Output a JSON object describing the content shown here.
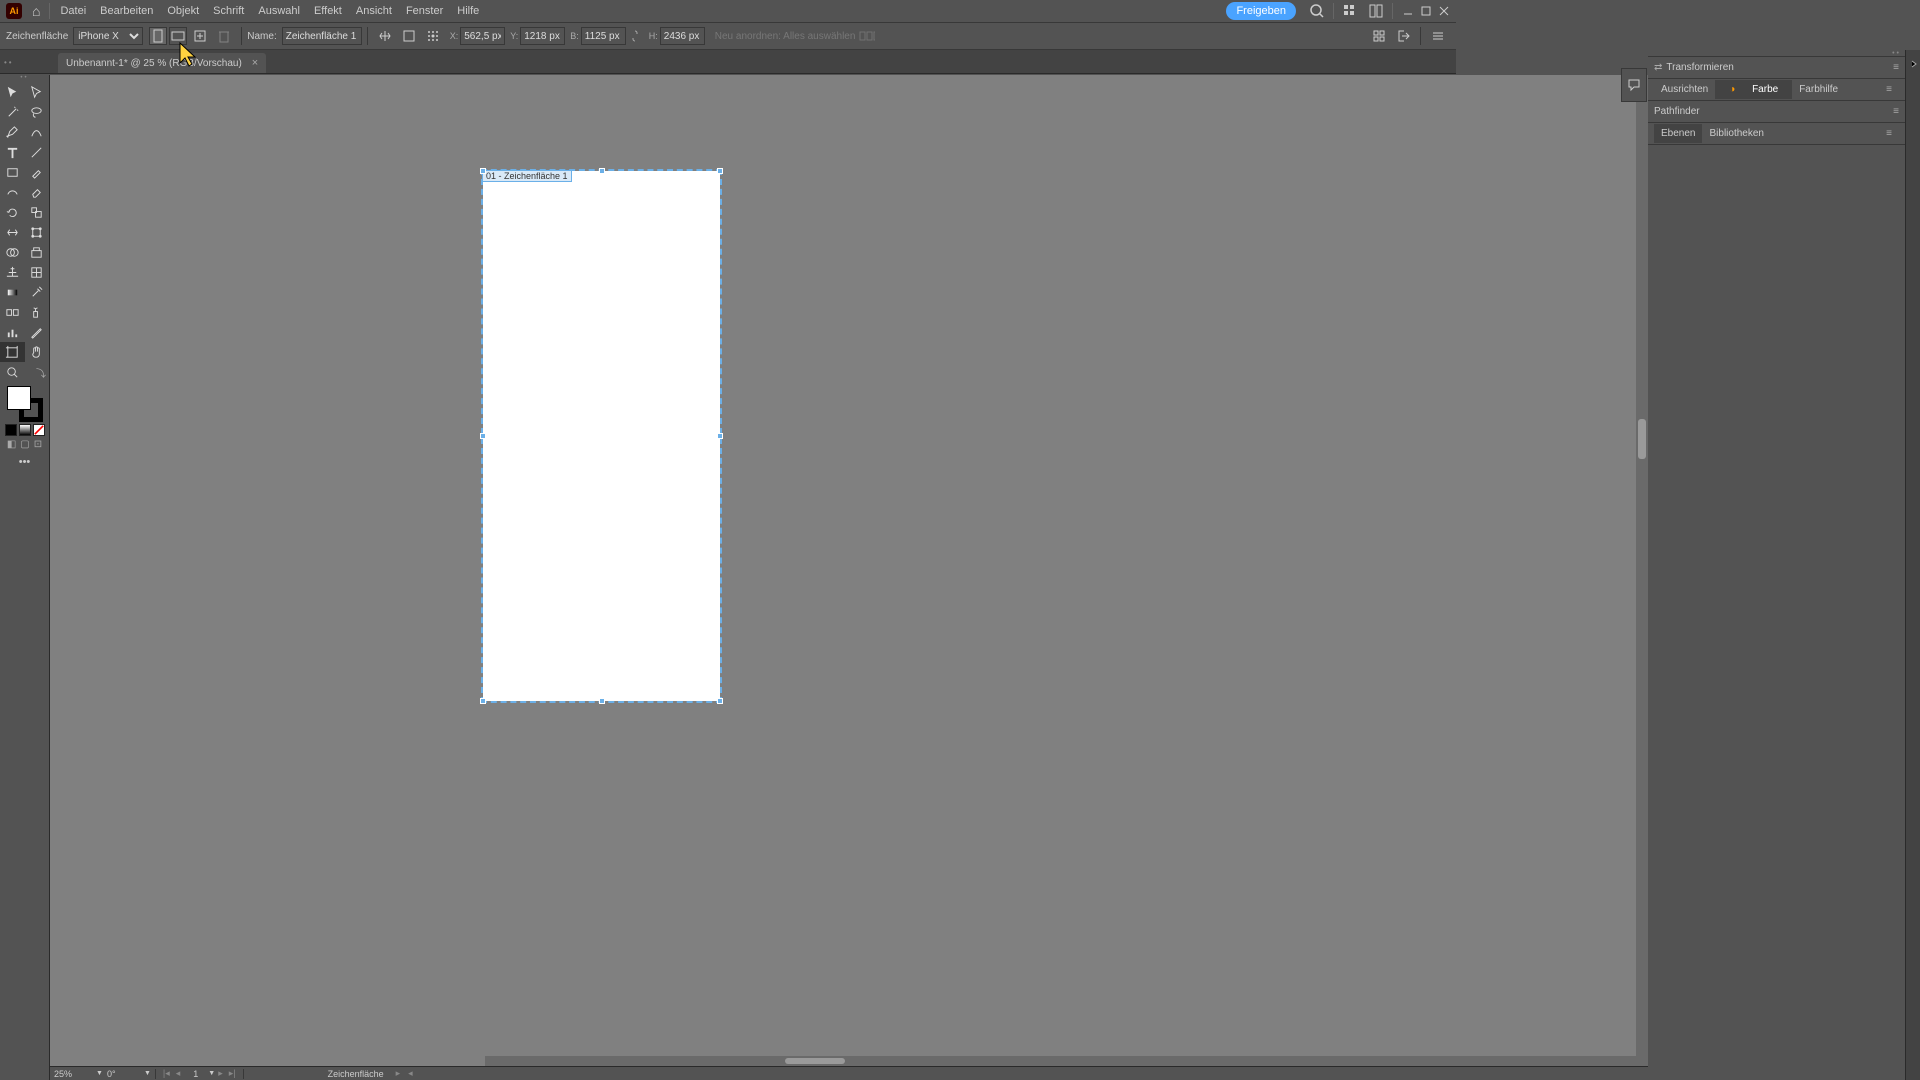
{
  "app": {
    "logo": "Ai"
  },
  "menubar": {
    "items": [
      "Datei",
      "Bearbeiten",
      "Objekt",
      "Schrift",
      "Auswahl",
      "Effekt",
      "Ansicht",
      "Fenster",
      "Hilfe"
    ],
    "share": "Freigeben"
  },
  "controlbar": {
    "tool_label": "Zeichenfläche",
    "preset": "iPhone X",
    "name_label": "Name:",
    "name_value": "Zeichenfläche 1",
    "x_label": "X:",
    "x_value": "562,5 px",
    "y_label": "Y:",
    "y_value": "1218 px",
    "w_label": "B:",
    "w_value": "1125 px",
    "h_label": "H:",
    "h_value": "2436 px",
    "dim_text": "Neu anordnen: Alles auswählen"
  },
  "document": {
    "tab_title": "Unbenannt-1* @ 25 % (RGB/Vorschau)"
  },
  "artboard": {
    "label": "01 - Zeichenfläche 1"
  },
  "right_panels": {
    "transform": "Transformieren",
    "align": "Ausrichten",
    "color": "Farbe",
    "color_help": "Farbhilfe",
    "pathfinder": "Pathfinder",
    "layers": "Ebenen",
    "libraries": "Bibliotheken"
  },
  "statusbar": {
    "zoom": "25%",
    "angle": "0°",
    "artboard_num": "1",
    "selection": "Zeichenfläche"
  }
}
